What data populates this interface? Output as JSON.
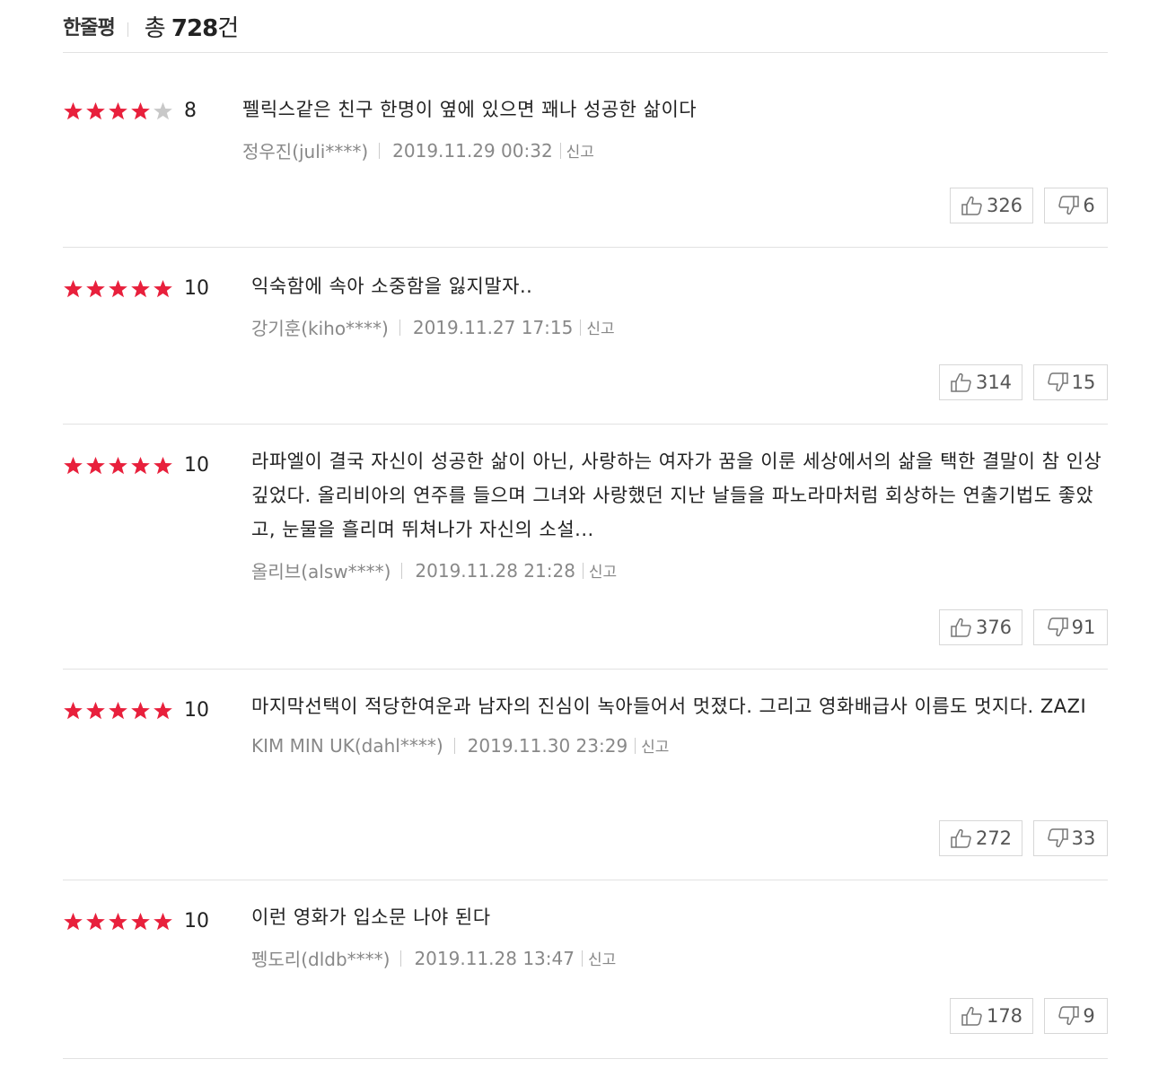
{
  "header": {
    "title": "한줄평",
    "count_prefix": "총 ",
    "count_number": "728",
    "count_suffix": "건"
  },
  "colors": {
    "star_filled": "#e8203c",
    "star_empty": "#c8c8c8"
  },
  "reviews": [
    {
      "stars": 4,
      "score": "8",
      "text": "펠릭스같은 친구 한명이 옆에 있으면 꽤나 성공한 삶이다",
      "author": "정우진(juli****)",
      "date": "2019.11.29 00:32",
      "report": "신고",
      "likes": "326",
      "dislikes": "6"
    },
    {
      "stars": 5,
      "score": "10",
      "text": "익숙함에 속아 소중함을 잃지말자..",
      "author": "강기훈(kiho****)",
      "date": "2019.11.27 17:15",
      "report": "신고",
      "likes": "314",
      "dislikes": "15"
    },
    {
      "stars": 5,
      "score": "10",
      "text": "라파엘이 결국 자신이 성공한 삶이 아닌, 사랑하는 여자가 꿈을 이룬 세상에서의 삶을 택한 결말이 참 인상깊었다. 올리비아의 연주를 들으며 그녀와 사랑했던 지난 날들을 파노라마처럼 회상하는 연출기법도 좋았고, 눈물을 흘리며 뛰쳐나가 자신의 소설...",
      "author": "올리브(alsw****)",
      "date": "2019.11.28 21:28",
      "report": "신고",
      "likes": "376",
      "dislikes": "91"
    },
    {
      "stars": 5,
      "score": "10",
      "text": "마지막선택이 적당한여운과 남자의 진심이 녹아들어서 멋졌다. 그리고 영화배급사 이름도 멋지다. ZAZI",
      "author": "KIM MIN UK(dahl****)",
      "date": "2019.11.30 23:29",
      "report": "신고",
      "likes": "272",
      "dislikes": "33"
    },
    {
      "stars": 5,
      "score": "10",
      "text": "이런 영화가 입소문 나야 된다",
      "author": "펭도리(dldb****)",
      "date": "2019.11.28 13:47",
      "report": "신고",
      "likes": "178",
      "dislikes": "9"
    }
  ]
}
